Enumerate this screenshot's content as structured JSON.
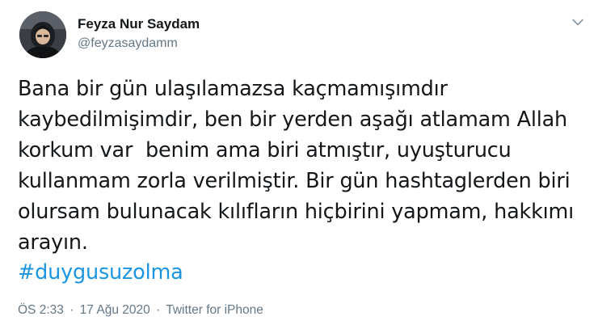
{
  "tweet": {
    "author": {
      "display_name": "Feyza Nur Saydam",
      "handle": "@feyzasaydamm",
      "avatar_icon": "profile-photo"
    },
    "menu_icon": "chevron-down-icon",
    "text_lines": [
      "Bana bir gün ulaşılamazsa kaçmamışımdır",
      "kaybedilmişimdir, ben bir yerden aşağı atlamam Allah",
      "korkum var  benim ama biri atmıştır, uyuşturucu",
      "kullanmam zorla verilmiştir. Bir gün hashtaglerden biri",
      "olursam bulunacak kılıfların hiçbirini yapmam, hakkımı",
      "arayın."
    ],
    "hashtag": "#duygusuzolma",
    "meta": {
      "time": "ÖS 2:33",
      "separator": "·",
      "date": "17 Ağu 2020",
      "source": "Twitter for iPhone"
    },
    "colors": {
      "text": "#14171a",
      "secondary": "#657786",
      "link": "#1b95e0"
    }
  }
}
